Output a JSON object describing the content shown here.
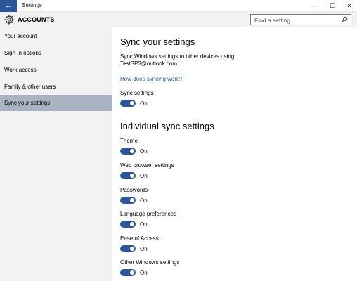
{
  "window": {
    "title": "Settings",
    "back_glyph": "←",
    "min_glyph": "—",
    "max_glyph": "☐",
    "close_glyph": "✕"
  },
  "header": {
    "title": "ACCOUNTS",
    "search_placeholder": "Find a setting",
    "icon": "gear-icon"
  },
  "sidebar": {
    "items": [
      {
        "label": "Your account"
      },
      {
        "label": "Sign-in options"
      },
      {
        "label": "Work access"
      },
      {
        "label": "Family & other users"
      },
      {
        "label": "Sync your settings"
      }
    ],
    "active_index": 4
  },
  "main": {
    "title": "Sync your settings",
    "description_line1": "Sync Windows settings to other devices using",
    "description_line2": "TestSP3@outlook.com.",
    "link": "How does syncing work?",
    "sync_settings": {
      "label": "Sync settings",
      "state": "On"
    },
    "individual_title": "Individual sync settings",
    "individual": [
      {
        "label": "Theme",
        "state": "On"
      },
      {
        "label": "Web browser settings",
        "state": "On"
      },
      {
        "label": "Passwords",
        "state": "On"
      },
      {
        "label": "Language preferences",
        "state": "On"
      },
      {
        "label": "Ease of Access",
        "state": "On"
      },
      {
        "label": "Other Windows settings",
        "state": "On"
      }
    ]
  },
  "colors": {
    "accent": "#2b579a",
    "sidebar_bg": "#f2f2f2",
    "active_item": "#a9b4c2",
    "link": "#2a5b9e"
  }
}
